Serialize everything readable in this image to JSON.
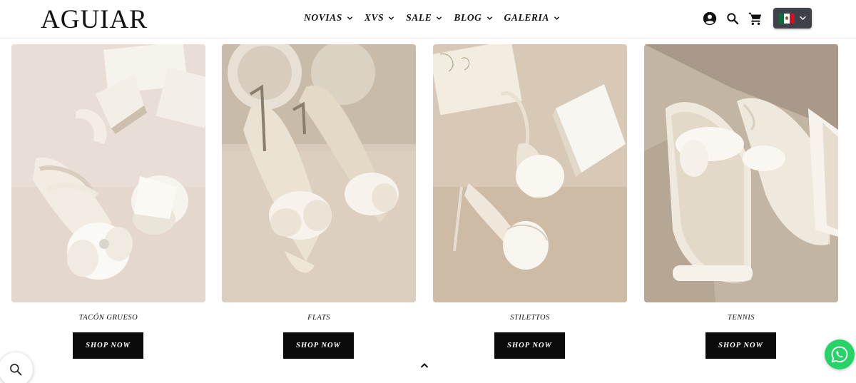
{
  "brand": {
    "logo_text": "AGUIAR"
  },
  "nav": {
    "items": [
      {
        "label": "NOVIAS"
      },
      {
        "label": "XVS"
      },
      {
        "label": "SALE"
      },
      {
        "label": "BLOG"
      },
      {
        "label": "GALERIA"
      }
    ]
  },
  "header_icons": {
    "account": "account-icon",
    "search": "search-icon",
    "cart": "cart-icon",
    "country": "mexico-flag-icon"
  },
  "products": [
    {
      "label": "TACÓN GRUESO",
      "button": "SHOP NOW"
    },
    {
      "label": "FLATS",
      "button": "SHOP NOW"
    },
    {
      "label": "STILETTOS",
      "button": "SHOP NOW"
    },
    {
      "label": "TENNIS",
      "button": "SHOP NOW"
    }
  ],
  "colors": {
    "button_bg": "#0b0b0b",
    "whatsapp": "#25d366",
    "flag_btn_bg": "#3e4147"
  }
}
